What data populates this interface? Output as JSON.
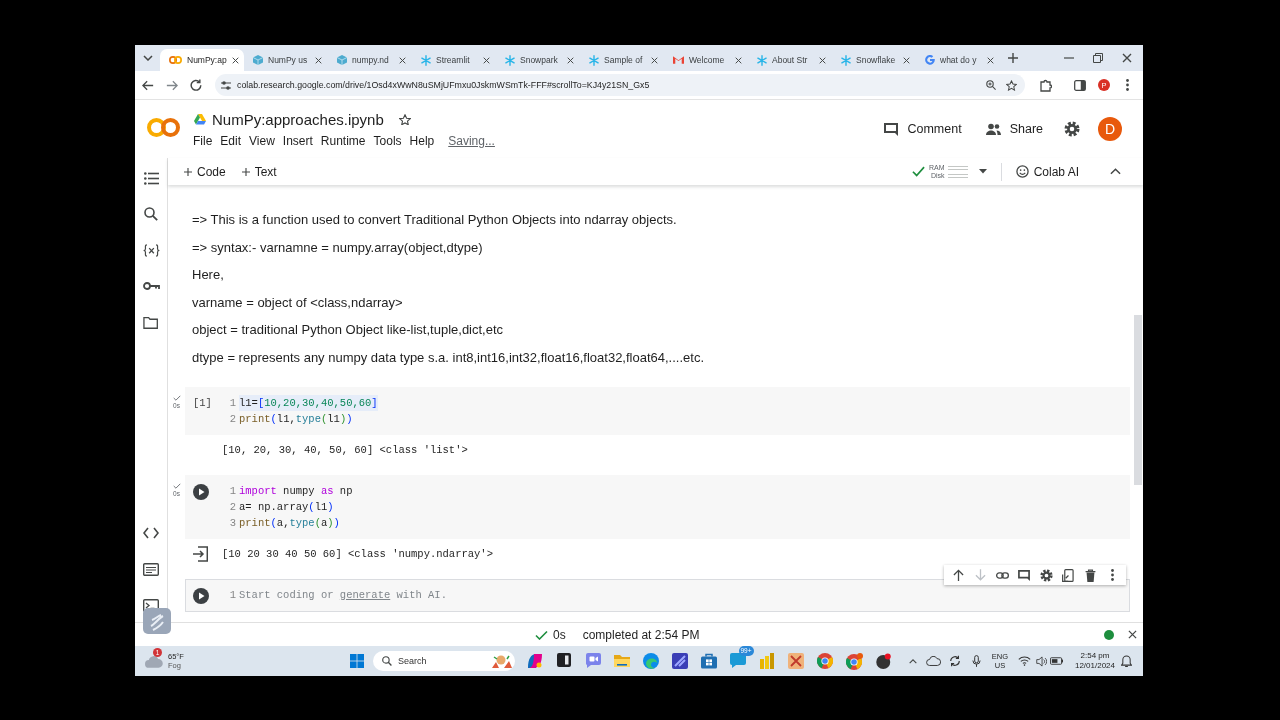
{
  "browser": {
    "tabs": [
      {
        "title": "NumPy:ap",
        "kind": "colab",
        "selected": true
      },
      {
        "title": "NumPy us",
        "kind": "numpy",
        "selected": false
      },
      {
        "title": "numpy.nd",
        "kind": "numpy",
        "selected": false
      },
      {
        "title": "Streamlit",
        "kind": "snowflake",
        "selected": false
      },
      {
        "title": "Snowpark",
        "kind": "snowflake",
        "selected": false
      },
      {
        "title": "Sample of",
        "kind": "snowflake",
        "selected": false
      },
      {
        "title": "Welcome",
        "kind": "gmail",
        "selected": false
      },
      {
        "title": "About Str",
        "kind": "snowflake",
        "selected": false
      },
      {
        "title": "Snowflake",
        "kind": "snowflake",
        "selected": false
      },
      {
        "title": "what do y",
        "kind": "google",
        "selected": false
      }
    ],
    "address": "colab.research.google.com/drive/1Osd4xWwN8uSMjUFmxu0JskmWSmTk-FFF#scrollTo=KJ4y21SN_Gx5",
    "profile": "P"
  },
  "header": {
    "title": "NumPy:approaches.ipynb",
    "menu": [
      "File",
      "Edit",
      "View",
      "Insert",
      "Runtime",
      "Tools",
      "Help"
    ],
    "save_status": "Saving...",
    "actions": [
      {
        "label": "Comment",
        "kind": "comment"
      },
      {
        "label": "Share",
        "kind": "share"
      }
    ],
    "avatar": "D"
  },
  "toolbar": {
    "add_buttons": [
      "Code",
      "Text"
    ],
    "resources": [
      "RAM",
      "Disk"
    ],
    "ai_button": "Colab AI"
  },
  "text_cell": [
    "=> This is a function used to convert Traditional Python Objects into ndarray objects.",
    "=> syntax:- varnamne = numpy.array(object,dtype)",
    "Here,",
    "varname = object of <class,ndarray>",
    "object = traditional Python Object like-list,tuple,dict,etc",
    "dtype = represents any numpy data type s.a. int8,int16,int32,float16,float32,float64,....etc."
  ],
  "cells": [
    {
      "selected": false,
      "exec_count": "[1]",
      "duration": "0s",
      "lines": [
        {
          "number": "1",
          "highlighted": true,
          "tokens": [
            {
              "text": "l1=",
              "kind": "plain"
            },
            {
              "text": "[",
              "kind": "bracket"
            },
            {
              "text": "10,20,30,40,50,60",
              "kind": "number"
            },
            {
              "text": "]",
              "kind": "bracket"
            }
          ]
        },
        {
          "number": "2",
          "highlighted": false,
          "tokens": [
            {
              "text": "print",
              "kind": "builtin"
            },
            {
              "text": "(",
              "kind": "bracket"
            },
            {
              "text": "l1,",
              "kind": "plain"
            },
            {
              "text": "type",
              "kind": "type"
            },
            {
              "text": "(",
              "kind": "bracket2"
            },
            {
              "text": "l1",
              "kind": "plain"
            },
            {
              "text": ")",
              "kind": "bracket2"
            },
            {
              "text": ")",
              "kind": "bracket"
            }
          ]
        }
      ],
      "output": {
        "text": "[10, 20, 30, 40, 50, 60] <class 'list'>",
        "hovered": false
      }
    },
    {
      "selected": false,
      "duration": "0s",
      "lines": [
        {
          "number": "1",
          "highlighted": false,
          "tokens": [
            {
              "text": "import",
              "kind": "keyword"
            },
            {
              "text": " numpy ",
              "kind": "plain"
            },
            {
              "text": "as",
              "kind": "keyword"
            },
            {
              "text": " np",
              "kind": "plain"
            }
          ]
        },
        {
          "number": "2",
          "highlighted": false,
          "tokens": [
            {
              "text": "a= np.array",
              "kind": "plain"
            },
            {
              "text": "(",
              "kind": "bracket"
            },
            {
              "text": "l1",
              "kind": "plain"
            },
            {
              "text": ")",
              "kind": "bracket"
            }
          ]
        },
        {
          "number": "3",
          "highlighted": false,
          "tokens": [
            {
              "text": "print",
              "kind": "builtin"
            },
            {
              "text": "(",
              "kind": "bracket"
            },
            {
              "text": "a,",
              "kind": "plain"
            },
            {
              "text": "type",
              "kind": "type"
            },
            {
              "text": "(",
              "kind": "bracket2"
            },
            {
              "text": "a",
              "kind": "plain"
            },
            {
              "text": ")",
              "kind": "bracket2"
            },
            {
              "text": ")",
              "kind": "bracket"
            }
          ]
        }
      ],
      "output": {
        "text": "[10 20 30 40 50 60] <class 'numpy.ndarray'>",
        "hovered": true
      }
    }
  ],
  "new_cell": {
    "selected": true,
    "line_number": "1",
    "hint": [
      {
        "text": "Start coding or",
        "link": false
      },
      {
        "text": "generate",
        "link": true
      },
      {
        "text": "with AI.",
        "link": false
      }
    ]
  },
  "status_bar": {
    "duration": "0s",
    "message": "completed at 2:54 PM"
  },
  "taskbar": {
    "weather": {
      "badge": "1",
      "temperature": "65°F",
      "condition": "Fog"
    },
    "search": {
      "placeholder": "Search"
    },
    "app_badge": "99+",
    "language": "ENG",
    "region": "US",
    "time": "2:54 pm",
    "date": "12/01/2024"
  }
}
